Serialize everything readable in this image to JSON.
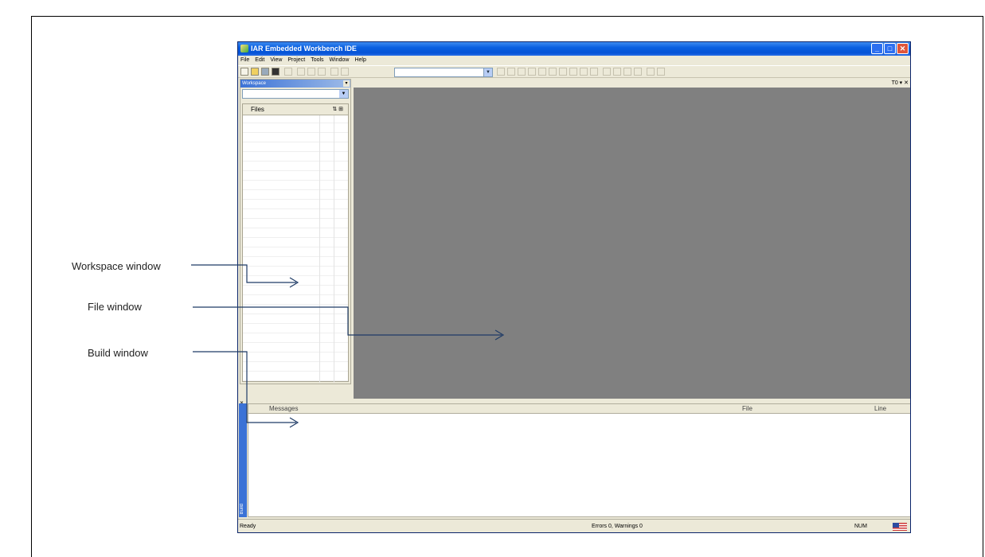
{
  "callouts": {
    "workspace": "Workspace window",
    "file": "File window",
    "build": "Build window"
  },
  "app": {
    "title": "IAR Embedded Workbench IDE",
    "window_buttons": [
      "_",
      "□",
      "✕"
    ]
  },
  "menu": [
    "File",
    "Edit",
    "View",
    "Project",
    "Tools",
    "Window",
    "Help"
  ],
  "workspace": {
    "title": "Workspace",
    "pin": "▾",
    "files_header": "Files",
    "header_icons": "⇅ ⊞"
  },
  "editor": {
    "header_controls": "T0 ▾ ✕"
  },
  "build": {
    "side_label": "Build",
    "columns": {
      "messages": "Messages",
      "file": "File",
      "line": "Line"
    }
  },
  "status": {
    "left": "Ready",
    "middle": "Errors 0, Warnings 0",
    "num": "NUM"
  },
  "colors": {
    "titlebar": "#0553d6",
    "editor_bg": "#808080",
    "arrow": "#1f3b66"
  }
}
